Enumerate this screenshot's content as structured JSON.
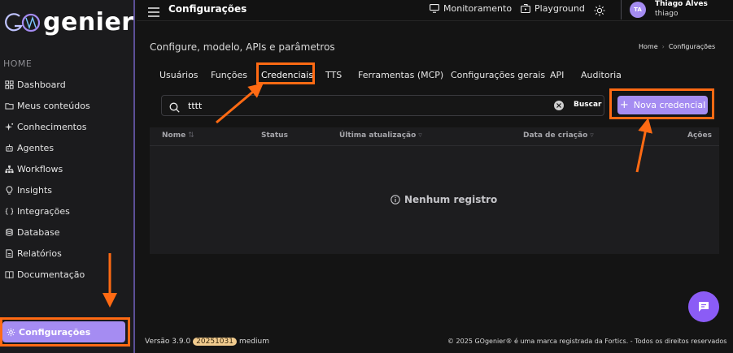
{
  "app": {
    "brand_prefix": "GO",
    "brand_name": "genier"
  },
  "sidebar": {
    "section_label": "HOME",
    "items": [
      {
        "label": "Dashboard",
        "icon": "grid-icon"
      },
      {
        "label": "Meus conteúdos",
        "icon": "folder-icon"
      },
      {
        "label": "Conhecimentos",
        "icon": "sparkle-icon"
      },
      {
        "label": "Agentes",
        "icon": "robot-icon"
      },
      {
        "label": "Workflows",
        "icon": "workflow-icon"
      },
      {
        "label": "Insights",
        "icon": "lightbulb-icon"
      },
      {
        "label": "Integrações",
        "icon": "code-braces-icon"
      },
      {
        "label": "Database",
        "icon": "database-icon"
      },
      {
        "label": "Relatórios",
        "icon": "report-icon"
      },
      {
        "label": "Documentação",
        "icon": "book-icon"
      }
    ],
    "active_item": {
      "label": "Configurações",
      "icon": "gear-icon"
    }
  },
  "header": {
    "title": "Configurações",
    "links": [
      {
        "label": "Monitoramento",
        "icon": "monitor-icon"
      },
      {
        "label": "Playground",
        "icon": "playground-icon"
      }
    ],
    "theme_icon": "sun-icon",
    "user": {
      "initials": "TA",
      "name": "Thiago Alves",
      "login": "thiago"
    }
  },
  "page": {
    "subtitle": "Configure, modelo, APIs e parâmetros",
    "breadcrumb": [
      "Home",
      "Configurações"
    ]
  },
  "tabs": [
    {
      "label": "Usuários",
      "active": false
    },
    {
      "label": "Funções",
      "active": false
    },
    {
      "label": "Credenciais",
      "active": true
    },
    {
      "label": "TTS",
      "active": false
    },
    {
      "label": "Ferramentas (MCP)",
      "active": false
    },
    {
      "label": "Configurações gerais",
      "active": false
    },
    {
      "label": "API",
      "active": false
    },
    {
      "label": "Auditoria",
      "active": false
    }
  ],
  "search": {
    "value": "tttt",
    "button_label": "Buscar"
  },
  "new_button": {
    "label": "Nova credencial",
    "icon": "plus-icon"
  },
  "table": {
    "columns": [
      "Nome",
      "Status",
      "Última atualização",
      "Data de criação",
      "Ações"
    ],
    "empty_message": "Nenhum registro"
  },
  "footer": {
    "version_label": "Versão 3.9.0",
    "build": "20251031",
    "build_suffix": "medium",
    "copyright": "© 2025 GOgenier® é uma marca registrada da Fortics. - Todos os direitos reservados"
  },
  "colors": {
    "accent": "#a58cf2",
    "annotation": "#ff6a13",
    "background": "#141414",
    "sidebar": "#1b1b1d"
  }
}
